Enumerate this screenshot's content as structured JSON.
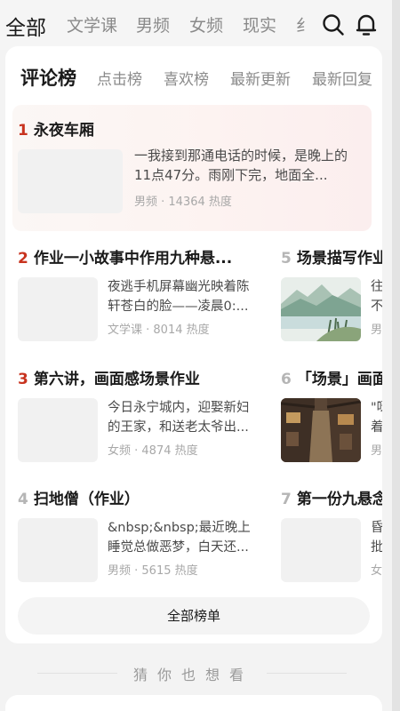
{
  "top_tabs": [
    "全部",
    "文学课",
    "男频",
    "女频",
    "现实",
    "纟"
  ],
  "rank_tabs": [
    "评论榜",
    "点击榜",
    "喜欢榜",
    "最新更新",
    "最新回复"
  ],
  "items": [
    {
      "rank": "1",
      "title": "永夜车厢",
      "desc": "一我接到那通电话的时候，是晚上的11点47分。雨刚下完，地面全...",
      "meta": "男频 · 14364 热度"
    },
    {
      "rank": "2",
      "title": "作业一小故事中作用九种悬...",
      "desc": "夜逃手机屏幕幽光映着陈轩苍白的脸——凌晨0:...",
      "meta": "文学课 · 8014 热度"
    },
    {
      "rank": "3",
      "title": "第六讲，画面感场景作业",
      "desc": "今日永宁城内，迎娶新妇的王家，和送老太爷出...",
      "meta": "女频 · 4874 热度"
    },
    {
      "rank": "4",
      "title": "扫地僧（作业）",
      "desc": "&nbsp;&nbsp;最近晚上睡觉总做恶梦，白天还...",
      "meta": "男频 · 5615 热度"
    },
    {
      "rank": "5",
      "title": "场景描写作业",
      "desc": "往不",
      "meta": "男"
    },
    {
      "rank": "6",
      "title": "「场景」画面",
      "desc": "\"呀着",
      "meta": "男"
    },
    {
      "rank": "7",
      "title": "第一份九悬念",
      "desc": "昏批",
      "meta": "女"
    }
  ],
  "all_button": "全部榜单",
  "guess_title": "猜你也想看",
  "icons": {
    "search": "search-icon",
    "bell": "bell-icon"
  }
}
